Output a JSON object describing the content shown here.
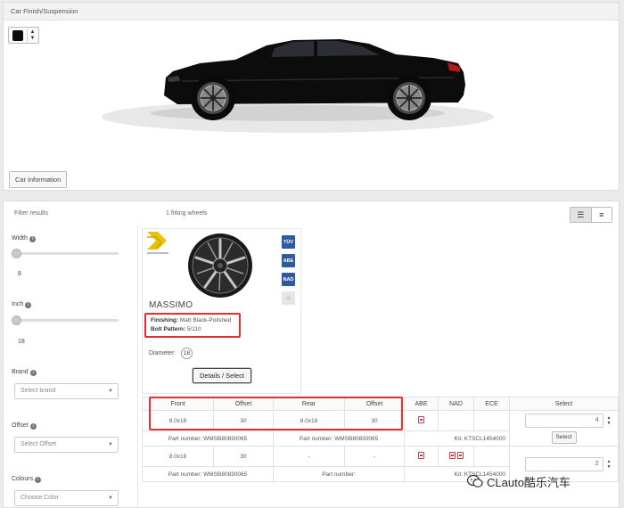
{
  "top_panel": {
    "title": "Car Finish/Suspension",
    "car_info_button": "Car information",
    "selected_color": "#0a0a0a"
  },
  "results": {
    "filter_label": "Filter results",
    "count_text": "1 fitting wheels"
  },
  "filters": {
    "width": {
      "label": "Width",
      "value": "8"
    },
    "inch": {
      "label": "Inch",
      "value": "18"
    },
    "brand": {
      "label": "Brand",
      "placeholder": "Select brand"
    },
    "offset": {
      "label": "Offset",
      "placeholder": "Select Offset"
    },
    "colours": {
      "label": "Colours",
      "placeholder": "Choose Color"
    }
  },
  "wheel": {
    "name": "MASSIMO",
    "finishing_label": "Finishing:",
    "finishing_value": "Matt Black-Polished",
    "bolt_label": "Bolt Pattern:",
    "bolt_value": "5/110",
    "diameter_label": "Diameter",
    "diameter_value": "18",
    "details_button": "Details / Select",
    "certifications": [
      "TÜV",
      "ABE",
      "NAD"
    ]
  },
  "table": {
    "headers": [
      "Front",
      "Offset",
      "Rear",
      "Offset",
      "ABE",
      "NAD",
      "ECE",
      "Select"
    ],
    "rows": [
      {
        "front": "8.0x18",
        "front_offset": "30",
        "rear": "8.0x18",
        "rear_offset": "30",
        "qty": "4",
        "part_front": "Part number: WMSB80830065",
        "part_rear": "Part number: WMSB80830065",
        "kit": "Kit: KTSCL1454000",
        "select_label": "Select"
      },
      {
        "front": "8.0x18",
        "front_offset": "30",
        "rear": "-",
        "rear_offset": "-",
        "qty": "2",
        "part_front": "Part number: WMSB80830065",
        "part_rear": "Part number:",
        "kit": "Kit: KTSCL1454000"
      }
    ]
  },
  "watermark": "CLauto酷乐汽车",
  "colors": {
    "highlight": "#e53030",
    "cert_blue": "#2d5aa3"
  }
}
